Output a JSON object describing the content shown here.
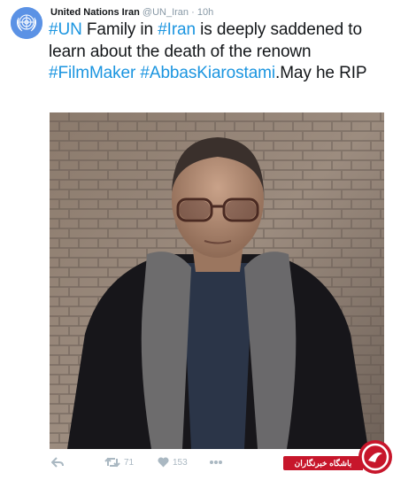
{
  "tweet": {
    "author": "United Nations Iran",
    "handle": "@UN_Iran",
    "separator": "·",
    "time": "10h",
    "text_parts": [
      {
        "text": "#UN",
        "tag": true
      },
      {
        "text": " Family in ",
        "tag": false
      },
      {
        "text": "#Iran",
        "tag": true
      },
      {
        "text": " is deeply saddened to learn about the death of the renown ",
        "tag": false
      },
      {
        "text": "#FilmMaker",
        "tag": true
      },
      {
        "text": " ",
        "tag": false
      },
      {
        "text": "#AbbasKiarostami",
        "tag": true
      },
      {
        "text": ".May he RIP",
        "tag": false
      }
    ]
  },
  "actions": {
    "retweet_count": "71",
    "like_count": "153"
  },
  "watermark": {
    "label": "باشگاه خبرنگاران"
  },
  "colors": {
    "link": "#1b95e0",
    "text": "#14171a",
    "muted": "#8899a6",
    "icon": "#aab8c2",
    "un_blue": "#5b92e5",
    "badge_red": "#c7162b"
  }
}
